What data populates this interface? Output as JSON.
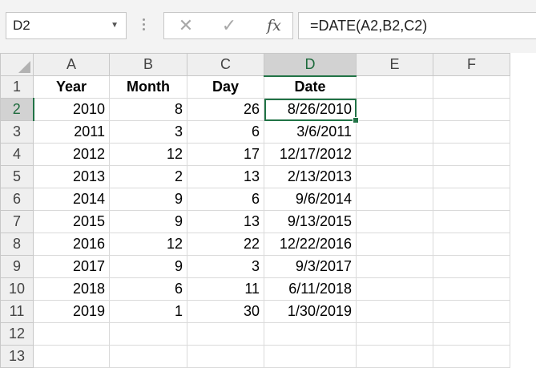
{
  "name_box": {
    "value": "D2",
    "dropdown_icon": "chevron-down-icon"
  },
  "formula_bar": {
    "cancel_icon": "close-icon",
    "enter_icon": "checkmark-icon",
    "fx_label": "fx",
    "formula": "=DATE(A2,B2,C2)"
  },
  "columns": [
    "A",
    "B",
    "C",
    "D",
    "E",
    "F"
  ],
  "selected_column": "D",
  "selected_row": 2,
  "rows": [
    {
      "n": "1",
      "a": "Year",
      "b": "Month",
      "c": "Day",
      "d": "Date"
    },
    {
      "n": "2",
      "a": "2010",
      "b": "8",
      "c": "26",
      "d": "8/26/2010"
    },
    {
      "n": "3",
      "a": "2011",
      "b": "3",
      "c": "6",
      "d": "3/6/2011"
    },
    {
      "n": "4",
      "a": "2012",
      "b": "12",
      "c": "17",
      "d": "12/17/2012"
    },
    {
      "n": "5",
      "a": "2013",
      "b": "2",
      "c": "13",
      "d": "2/13/2013"
    },
    {
      "n": "6",
      "a": "2014",
      "b": "9",
      "c": "6",
      "d": "9/6/2014"
    },
    {
      "n": "7",
      "a": "2015",
      "b": "9",
      "c": "13",
      "d": "9/13/2015"
    },
    {
      "n": "8",
      "a": "2016",
      "b": "12",
      "c": "22",
      "d": "12/22/2016"
    },
    {
      "n": "9",
      "a": "2017",
      "b": "9",
      "c": "3",
      "d": "9/3/2017"
    },
    {
      "n": "10",
      "a": "2018",
      "b": "6",
      "c": "11",
      "d": "6/11/2018"
    },
    {
      "n": "11",
      "a": "2019",
      "b": "1",
      "c": "30",
      "d": "1/30/2019"
    },
    {
      "n": "12",
      "a": "",
      "b": "",
      "c": "",
      "d": ""
    },
    {
      "n": "13",
      "a": "",
      "b": "",
      "c": "",
      "d": ""
    }
  ]
}
